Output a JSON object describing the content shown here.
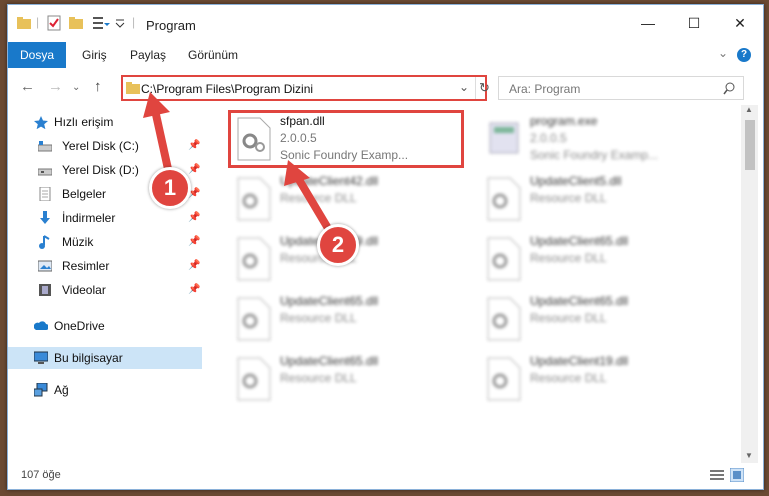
{
  "window": {
    "title": "Program",
    "controls": {
      "minimize": "—",
      "maximize": "☐",
      "close": "✕"
    }
  },
  "ribbon": {
    "tabs": [
      {
        "label": "Dosya",
        "active": true
      },
      {
        "label": "Giriş"
      },
      {
        "label": "Paylaş"
      },
      {
        "label": "Görünüm"
      }
    ]
  },
  "navigation": {
    "address": "C:\\Program Files\\Program Dizini",
    "search_placeholder": "Ara: Program"
  },
  "sidebar": {
    "items": [
      {
        "label": "Hızlı erişim",
        "icon": "star-icon",
        "pinned": false
      },
      {
        "label": "Yerel Disk (C:)",
        "icon": "drive-icon",
        "pinned": true
      },
      {
        "label": "Yerel Disk (D:)",
        "icon": "drive-icon",
        "pinned": true
      },
      {
        "label": "Belgeler",
        "icon": "documents-icon",
        "pinned": true
      },
      {
        "label": "İndirmeler",
        "icon": "downloads-icon",
        "pinned": true
      },
      {
        "label": "Müzik",
        "icon": "music-icon",
        "pinned": true
      },
      {
        "label": "Resimler",
        "icon": "pictures-icon",
        "pinned": true
      },
      {
        "label": "Videolar",
        "icon": "videos-icon",
        "pinned": true
      },
      {
        "label": "OneDrive",
        "icon": "onedrive-icon",
        "pinned": false
      },
      {
        "label": "Bu bilgisayar",
        "icon": "computer-icon",
        "pinned": false,
        "selected": true
      },
      {
        "label": "Ağ",
        "icon": "network-icon",
        "pinned": false
      }
    ]
  },
  "files": [
    {
      "name": "sfpan.dll",
      "line2": "2.0.0.5",
      "line3": "Sonic Foundry Examp...",
      "highlight": true
    },
    {
      "name": "program.exe",
      "line2": "2.0.0.5",
      "line3": "Sonic Foundry Examp..."
    },
    {
      "name": "UpdateClient42.dll",
      "line2": "Resource DLL"
    },
    {
      "name": "UpdateClient5.dll",
      "line2": "Resource DLL"
    },
    {
      "name": "UpdateClient49.dll",
      "line2": "Resource DLL"
    },
    {
      "name": "UpdateClient65.dll",
      "line2": "Resource DLL"
    },
    {
      "name": "UpdateClient65.dll",
      "line2": "Resource DLL"
    },
    {
      "name": "UpdateClient65.dll",
      "line2": "Resource DLL"
    },
    {
      "name": "UpdateClient65.dll",
      "line2": "Resource DLL"
    },
    {
      "name": "UpdateClient19.dll",
      "line2": "Resource DLL"
    }
  ],
  "status": {
    "count": "107 öğe"
  },
  "annotations": {
    "badge1": "1",
    "badge2": "2"
  },
  "colors": {
    "accent": "#1979ca",
    "highlight": "#e0453f"
  }
}
